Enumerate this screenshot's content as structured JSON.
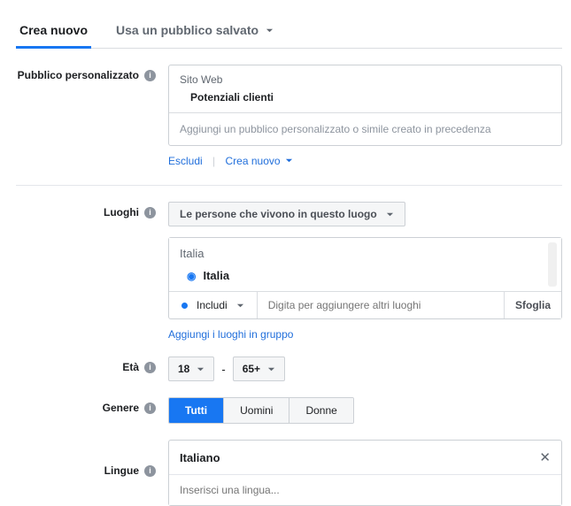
{
  "tabs": {
    "create": "Crea nuovo",
    "saved": "Usa un pubblico salvato"
  },
  "labels": {
    "custom_audience": "Pubblico personalizzato",
    "locations": "Luoghi",
    "age": "Età",
    "gender": "Genere",
    "languages": "Lingue"
  },
  "custom": {
    "source": "Sito Web",
    "name": "Potenziali clienti",
    "placeholder": "Aggiungi un pubblico personalizzato o simile creato in precedenza",
    "exclude": "Escludi",
    "create_new": "Crea nuovo"
  },
  "locations": {
    "mode": "Le persone che vivono in questo luogo",
    "group": "Italia",
    "item": "Italia",
    "include": "Includi",
    "input_placeholder": "Digita per aggiungere altri luoghi",
    "browse": "Sfoglia",
    "bulk": "Aggiungi i luoghi in gruppo"
  },
  "age": {
    "min": "18",
    "sep": "-",
    "max": "65+"
  },
  "gender": {
    "all": "Tutti",
    "men": "Uomini",
    "women": "Donne"
  },
  "languages": {
    "item": "Italiano",
    "placeholder": "Inserisci una lingua..."
  }
}
